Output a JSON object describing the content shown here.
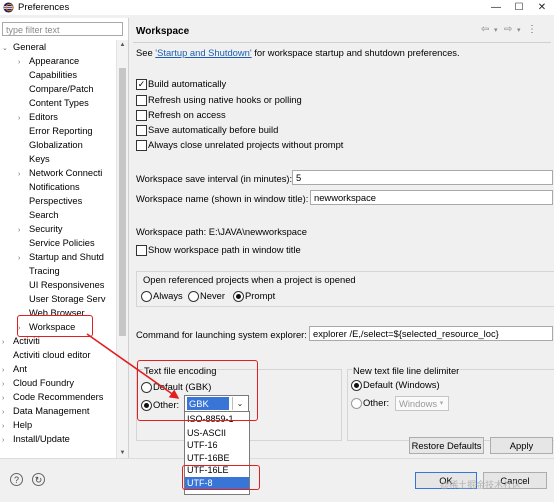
{
  "window": {
    "title": "Preferences"
  },
  "left": {
    "filter_placeholder": "type filter text",
    "tree": [
      {
        "label": "General",
        "twisty": "⌄"
      },
      {
        "label": "Appearance",
        "twisty": "›"
      },
      {
        "label": "Capabilities",
        "twisty": ""
      },
      {
        "label": "Compare/Patch",
        "twisty": ""
      },
      {
        "label": "Content Types",
        "twisty": ""
      },
      {
        "label": "Editors",
        "twisty": "›"
      },
      {
        "label": "Error Reporting",
        "twisty": ""
      },
      {
        "label": "Globalization",
        "twisty": ""
      },
      {
        "label": "Keys",
        "twisty": ""
      },
      {
        "label": "Network Connecti",
        "twisty": "›"
      },
      {
        "label": "Notifications",
        "twisty": ""
      },
      {
        "label": "Perspectives",
        "twisty": ""
      },
      {
        "label": "Search",
        "twisty": ""
      },
      {
        "label": "Security",
        "twisty": "›"
      },
      {
        "label": "Service Policies",
        "twisty": ""
      },
      {
        "label": "Startup and Shutd",
        "twisty": "›"
      },
      {
        "label": "Tracing",
        "twisty": ""
      },
      {
        "label": "UI Responsivenes",
        "twisty": ""
      },
      {
        "label": "User Storage Serv",
        "twisty": ""
      },
      {
        "label": "Web Browser",
        "twisty": ""
      },
      {
        "label": "Workspace",
        "twisty": "›"
      },
      {
        "label": "Activiti",
        "twisty": "›"
      },
      {
        "label": "Activiti cloud editor",
        "twisty": ""
      },
      {
        "label": "Ant",
        "twisty": "›"
      },
      {
        "label": "Cloud Foundry",
        "twisty": "›"
      },
      {
        "label": "Code Recommenders",
        "twisty": "›"
      },
      {
        "label": "Data Management",
        "twisty": "›"
      },
      {
        "label": "Help",
        "twisty": "›"
      },
      {
        "label": "Install/Update",
        "twisty": "›"
      }
    ]
  },
  "page": {
    "title": "Workspace",
    "intro_pre": "See ",
    "intro_link": "'Startup and Shutdown'",
    "intro_post": " for workspace startup and shutdown preferences.",
    "checkboxes": [
      {
        "label": "Build automatically",
        "checked": "✓"
      },
      {
        "label": "Refresh using native hooks or polling",
        "checked": ""
      },
      {
        "label": "Refresh on access",
        "checked": ""
      },
      {
        "label": "Save automatically before build",
        "checked": ""
      },
      {
        "label": "Always close unrelated projects without prompt",
        "checked": ""
      }
    ],
    "save_interval_label": "Workspace save interval (in minutes):",
    "save_interval_value": "5",
    "ws_name_label": "Workspace name (shown in window title):",
    "ws_name_value": "newworkspace",
    "ws_path_label": "Workspace path:",
    "ws_path_value": "E:\\JAVA\\newworkspace",
    "show_path_label": "Show workspace path in window title",
    "open_ref": {
      "title": "Open referenced projects when a project is opened",
      "options": [
        "Always",
        "Never",
        "Prompt"
      ]
    },
    "cmd_label": "Command for launching system explorer:",
    "cmd_value": "explorer /E,/select=${selected_resource_loc}",
    "encoding": {
      "title": "Text file encoding",
      "default_label": "Default (GBK)",
      "other_label": "Other:",
      "selected": "GBK",
      "options": [
        "ISO-8859-1",
        "US-ASCII",
        "UTF-16",
        "UTF-16BE",
        "UTF-16LE",
        "UTF-8"
      ]
    },
    "line_delim": {
      "title": "New text file line delimiter",
      "default_label": "Default (Windows)",
      "other_label": "Other:",
      "other_value": "Windows"
    },
    "restore_label": "Restore Defaults",
    "apply_label": "Apply"
  },
  "bottom": {
    "ok_label": "OK",
    "cancel_label": "Cancel",
    "watermark": "@稀土掘金技术社区"
  },
  "colors": {
    "annotation": "#e02020",
    "selection": "#3875d7",
    "link": "#1a5fb4"
  }
}
